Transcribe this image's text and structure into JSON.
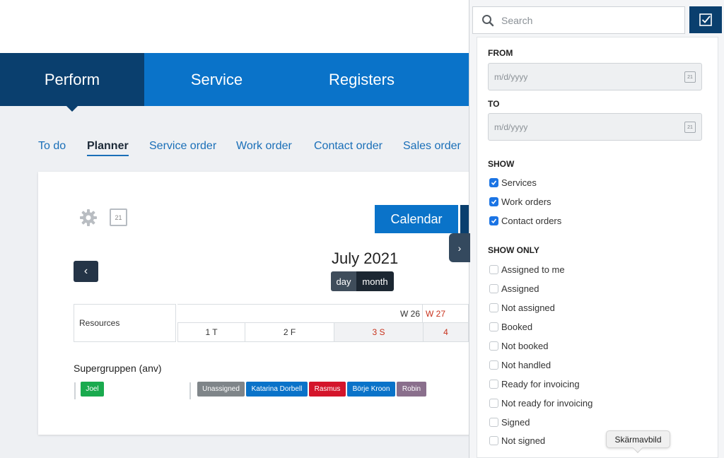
{
  "main_nav": {
    "items": [
      {
        "label": "Perform",
        "active": true
      },
      {
        "label": "Service",
        "active": false
      },
      {
        "label": "Registers",
        "active": false
      }
    ]
  },
  "sub_nav": {
    "items": [
      {
        "label": "To do",
        "active": false
      },
      {
        "label": "Planner",
        "active": true
      },
      {
        "label": "Service order",
        "active": false
      },
      {
        "label": "Work order",
        "active": false
      },
      {
        "label": "Contact order",
        "active": false
      },
      {
        "label": "Sales order",
        "active": false
      }
    ]
  },
  "planner": {
    "calendar_icon_day": "21",
    "calendar_button": "Calendar",
    "panel_toggle_icon": "›",
    "prev_icon": "‹",
    "month_title": "July 2021",
    "view_day": "day",
    "view_month": "month",
    "resources_header": "Resources",
    "weeks": [
      {
        "label": "W 26",
        "current": false
      },
      {
        "label": "W 27",
        "current": true
      }
    ],
    "days": [
      {
        "label": "1 T",
        "weekend": false
      },
      {
        "label": "2 F",
        "weekend": false
      },
      {
        "label": "3 S",
        "weekend": true
      },
      {
        "label": "4",
        "weekend": true
      }
    ],
    "group_title": "Supergruppen (anv)",
    "tags": [
      {
        "label": "Joel",
        "color": "#1aaa4e"
      },
      {
        "label": "Unassigned",
        "color": "#7f8589"
      },
      {
        "label": "Katarina Dorbell",
        "color": "#0a73c9"
      },
      {
        "label": "Rasmus",
        "color": "#d4152b"
      },
      {
        "label": "Börje Kroon",
        "color": "#0a73c9"
      },
      {
        "label": "Robin",
        "color": "#8a6f8c"
      }
    ]
  },
  "filter_panel": {
    "search_placeholder": "Search",
    "from_label": "FROM",
    "from_placeholder": "m/d/yyyy",
    "to_label": "TO",
    "to_placeholder": "m/d/yyyy",
    "date_icon_day": "21",
    "show_label": "SHOW",
    "show_items": [
      {
        "label": "Services",
        "checked": true
      },
      {
        "label": "Work orders",
        "checked": true
      },
      {
        "label": "Contact orders",
        "checked": true
      }
    ],
    "show_only_label": "SHOW ONLY",
    "show_only_items": [
      {
        "label": "Assigned to me",
        "checked": false
      },
      {
        "label": "Assigned",
        "checked": false
      },
      {
        "label": "Not assigned",
        "checked": false
      },
      {
        "label": "Booked",
        "checked": false
      },
      {
        "label": "Not booked",
        "checked": false
      },
      {
        "label": "Not handled",
        "checked": false
      },
      {
        "label": "Ready for invoicing",
        "checked": false
      },
      {
        "label": "Not ready for invoicing",
        "checked": false
      },
      {
        "label": "Signed",
        "checked": false
      },
      {
        "label": "Not signed",
        "checked": false
      }
    ]
  },
  "tooltip": {
    "label": "Skärmavbild"
  },
  "colors": {
    "primary": "#0a73c9",
    "dark": "#0a3f6e",
    "weekend_text": "#c8321c",
    "checkbox": "#1b74e4"
  }
}
